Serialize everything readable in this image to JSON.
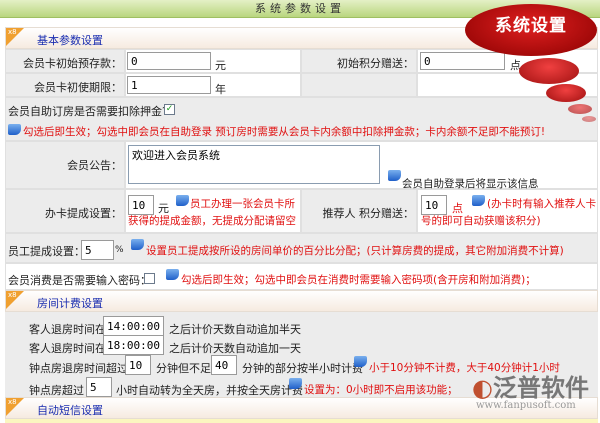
{
  "header": {
    "title": "系统参数设置"
  },
  "badge": {
    "text": "系统设置"
  },
  "sections": {
    "basic": "基本参数设置",
    "room": "房间计费设置",
    "sms": "自动短信设置",
    "tag": "x8"
  },
  "basic": {
    "prepay_label": "会员卡初始预存款：",
    "prepay_value": "0",
    "prepay_unit": "元",
    "points_label": "初始积分赠送：",
    "points_value": "0",
    "points_unit": "点",
    "period_label": "会员卡初使期限：",
    "period_value": "1",
    "period_unit": "年",
    "deposit_label": "会员自助订房是否需要扣除押金?",
    "deposit_checked": true,
    "deposit_note": "勾选后即生效；勾选中即会员在自助登录 预订房时需要从会员卡内余额中扣除押金款；卡内余额不足即不能预订!",
    "notice_label": "会员公告：",
    "notice_value": "欢迎进入会员系统",
    "notice_note": "会员自助登录后将显示该信息",
    "card_comm_label": "办卡提成设置：",
    "card_comm_value": "10",
    "card_comm_unit": "元",
    "card_comm_note": "员工办理一张会员卡所获得的提成金额，无提成分配请留空",
    "ref_label": "推荐人 积分赠送：",
    "ref_value": "10",
    "ref_unit": "点",
    "ref_note": "(办卡时有输入推荐人卡号的即可自动获赠该积分)",
    "staff_label": "员工提成设置：",
    "staff_value": "5",
    "staff_unit": "%",
    "staff_note": "设置员工提成按所设的房间单价的百分比分配；(只计算房费的提成，其它附加消费不计算)",
    "pwd_label": "会员消费是否需要输入密码：",
    "pwd_checked": false,
    "pwd_note": "勾选后即生效；勾选中即会员在消费时需要输入密码项(含开房和附加消费)；"
  },
  "room": {
    "half_pre": "客人退房时间在",
    "half_value": "14:00:00",
    "half_post": "之后计价天数自动追加半天",
    "full_pre": "客人退房时间在",
    "full_value": "18:00:00",
    "full_post": "之后计价天数自动追加一天",
    "hour_pre": "钟点房退房时间超过",
    "hour_min1": "10",
    "hour_mid": "分钟但不足",
    "hour_min2": "40",
    "hour_post": "分钟的部分按半小时计费",
    "hour_note": "小于10分钟不计费，大于40分钟计1小时",
    "conv_pre": "钟点房超过",
    "conv_value": "5",
    "conv_post": "小时自动转为全天房，并按全天房计费",
    "conv_note": "设置为：0小时即不启用该功能；"
  },
  "watermark": {
    "brand": "泛普软件",
    "url": "www.fanpusoft.com"
  }
}
